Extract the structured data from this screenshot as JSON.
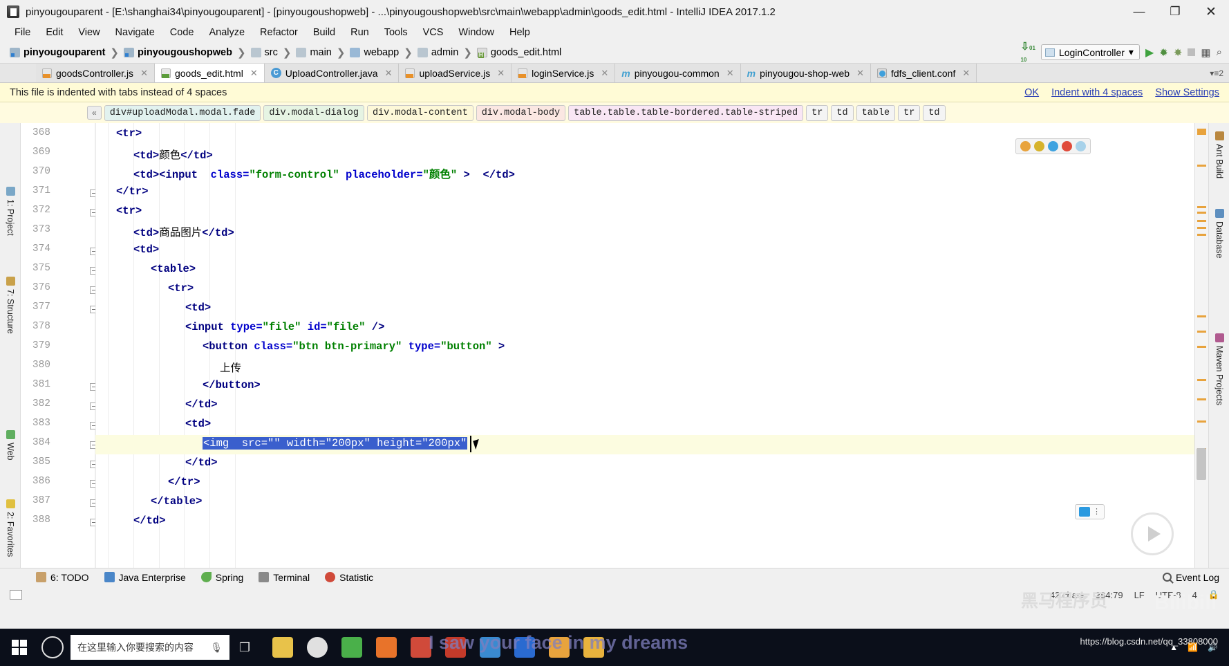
{
  "window": {
    "title": "pinyougouparent - [E:\\shanghai34\\pinyougouparent] - [pinyougoushopweb] - ...\\pinyougoushopweb\\src\\main\\webapp\\admin\\goods_edit.html - IntelliJ IDEA 2017.1.2",
    "minimize": "—",
    "maximize": "❐",
    "close": "✕"
  },
  "menubar": {
    "items": [
      "File",
      "Edit",
      "View",
      "Navigate",
      "Code",
      "Analyze",
      "Refactor",
      "Build",
      "Run",
      "Tools",
      "VCS",
      "Window",
      "Help"
    ]
  },
  "navbar": {
    "crumbs": [
      {
        "label": "pinyougouparent",
        "icon": "module-icon",
        "bold": true
      },
      {
        "label": "pinyougoushopweb",
        "icon": "module-icon",
        "bold": true
      },
      {
        "label": "src",
        "icon": "folder-icon",
        "bold": false
      },
      {
        "label": "main",
        "icon": "folder-icon",
        "bold": false
      },
      {
        "label": "webapp",
        "icon": "folder-blue-icon",
        "bold": false
      },
      {
        "label": "admin",
        "icon": "folder-icon",
        "bold": false
      },
      {
        "label": "goods_edit.html",
        "icon": "html-file-icon",
        "bold": false
      }
    ],
    "separator": "❯",
    "run_config": "LoginController",
    "dropdown_caret": "▾",
    "run_icon": "▶",
    "debug_icon": "🐞",
    "stop_icon": "■",
    "search_icon": "search-icon"
  },
  "tabs": [
    {
      "label": "goodsController.js",
      "icon": "js-file-icon",
      "active": false,
      "close": "✕"
    },
    {
      "label": "goods_edit.html",
      "icon": "html-file-icon",
      "active": true,
      "close": "✕"
    },
    {
      "label": "UploadController.java",
      "icon": "java-class-icon",
      "active": false,
      "close": "✕"
    },
    {
      "label": "uploadService.js",
      "icon": "js-file-icon",
      "active": false,
      "close": "✕"
    },
    {
      "label": "loginService.js",
      "icon": "js-file-icon",
      "active": false,
      "close": "✕"
    },
    {
      "label": "pinyougou-common",
      "icon": "maven-module-icon",
      "active": false,
      "close": "✕"
    },
    {
      "label": "pinyougou-shop-web",
      "icon": "maven-module-icon",
      "active": false,
      "close": "✕"
    },
    {
      "label": "fdfs_client.conf",
      "icon": "conf-file-icon",
      "active": false,
      "close": "✕"
    }
  ],
  "tabs_overflow": "▾≡2",
  "notification": {
    "message": "This file is indented with tabs instead of 4 spaces",
    "links": [
      "OK",
      "Indent with 4 spaces",
      "Show Settings"
    ]
  },
  "breadcrumbs": {
    "collapse": "«",
    "chips": [
      "div#uploadModal.modal.fade",
      "div.modal-dialog",
      "div.modal-content",
      "div.modal-body",
      "table.table.table-bordered.table-striped",
      "tr",
      "td",
      "table",
      "tr",
      "td"
    ]
  },
  "left_toolwindows": [
    {
      "label": "1: Project",
      "icon": "project-icon"
    },
    {
      "label": "7: Structure",
      "icon": "structure-icon"
    },
    {
      "label": "Web",
      "icon": "web-icon"
    },
    {
      "label": "2: Favorites",
      "icon": "favorites-icon"
    }
  ],
  "right_toolwindows": [
    {
      "label": "Ant Build",
      "icon": "ant-icon"
    },
    {
      "label": "Database",
      "icon": "database-icon"
    },
    {
      "label": "Maven Projects",
      "icon": "maven-icon"
    }
  ],
  "editor": {
    "first_line": 368,
    "lines": [
      {
        "no": 368,
        "indent": 4,
        "segs": [
          {
            "t": "<tr>",
            "c": "tag"
          }
        ]
      },
      {
        "no": 369,
        "indent": 5,
        "segs": [
          {
            "t": "<td>",
            "c": "tag"
          },
          {
            "t": "颜色",
            "c": "txt"
          },
          {
            "t": "</td>",
            "c": "tag"
          }
        ]
      },
      {
        "no": 370,
        "indent": 5,
        "segs": [
          {
            "t": "<td>",
            "c": "tag"
          },
          {
            "t": "<input",
            "c": "tag"
          },
          {
            "t": "  ",
            "c": "txt"
          },
          {
            "t": "class=",
            "c": "attr"
          },
          {
            "t": "\"form-control\"",
            "c": "val"
          },
          {
            "t": " ",
            "c": "txt"
          },
          {
            "t": "placeholder=",
            "c": "attr"
          },
          {
            "t": "\"颜色\"",
            "c": "val"
          },
          {
            "t": " >",
            "c": "tag"
          },
          {
            "t": "  ",
            "c": "txt"
          },
          {
            "t": "</td>",
            "c": "tag"
          }
        ]
      },
      {
        "no": 371,
        "indent": 4,
        "segs": [
          {
            "t": "</tr>",
            "c": "tag"
          }
        ]
      },
      {
        "no": 372,
        "indent": 4,
        "segs": [
          {
            "t": "<tr>",
            "c": "tag"
          }
        ]
      },
      {
        "no": 373,
        "indent": 5,
        "segs": [
          {
            "t": "<td>",
            "c": "tag"
          },
          {
            "t": "商品图片",
            "c": "txt"
          },
          {
            "t": "</td>",
            "c": "tag"
          }
        ]
      },
      {
        "no": 374,
        "indent": 5,
        "segs": [
          {
            "t": "<td>",
            "c": "tag"
          }
        ]
      },
      {
        "no": 375,
        "indent": 6,
        "segs": [
          {
            "t": "<table>",
            "c": "tag"
          }
        ]
      },
      {
        "no": 376,
        "indent": 7,
        "segs": [
          {
            "t": "<tr>",
            "c": "tag"
          }
        ]
      },
      {
        "no": 377,
        "indent": 8,
        "segs": [
          {
            "t": "<td>",
            "c": "tag"
          }
        ]
      },
      {
        "no": 378,
        "indent": 8,
        "segs": [
          {
            "t": "<input ",
            "c": "tag"
          },
          {
            "t": "type=",
            "c": "attr"
          },
          {
            "t": "\"file\"",
            "c": "val"
          },
          {
            "t": " ",
            "c": "txt"
          },
          {
            "t": "id=",
            "c": "attr"
          },
          {
            "t": "\"file\"",
            "c": "val"
          },
          {
            "t": " />",
            "c": "tag"
          }
        ]
      },
      {
        "no": 379,
        "indent": 9,
        "segs": [
          {
            "t": "<button ",
            "c": "tag"
          },
          {
            "t": "class=",
            "c": "attr"
          },
          {
            "t": "\"btn btn-primary\"",
            "c": "val"
          },
          {
            "t": " ",
            "c": "txt"
          },
          {
            "t": "type=",
            "c": "attr"
          },
          {
            "t": "\"button\"",
            "c": "val"
          },
          {
            "t": " >",
            "c": "tag"
          }
        ]
      },
      {
        "no": 380,
        "indent": 10,
        "segs": [
          {
            "t": "上传",
            "c": "txt"
          }
        ]
      },
      {
        "no": 381,
        "indent": 9,
        "segs": [
          {
            "t": "</button>",
            "c": "tag"
          }
        ]
      },
      {
        "no": 382,
        "indent": 8,
        "segs": [
          {
            "t": "</td>",
            "c": "tag"
          }
        ]
      },
      {
        "no": 383,
        "indent": 8,
        "segs": [
          {
            "t": "<td>",
            "c": "tag"
          }
        ]
      },
      {
        "no": 384,
        "indent": 9,
        "segs": [
          {
            "t": "<img  src=\"\" width=\"200px\" height=\"200px\"",
            "c": "sel"
          }
        ]
      },
      {
        "no": 385,
        "indent": 8,
        "segs": [
          {
            "t": "</td>",
            "c": "tag"
          }
        ]
      },
      {
        "no": 386,
        "indent": 7,
        "segs": [
          {
            "t": "</tr>",
            "c": "tag"
          }
        ]
      },
      {
        "no": 387,
        "indent": 6,
        "segs": [
          {
            "t": "</table>",
            "c": "tag"
          }
        ]
      },
      {
        "no": 388,
        "indent": 5,
        "segs": [
          {
            "t": "</td>",
            "c": "tag"
          }
        ]
      }
    ],
    "selected_text": "<img  src=\"\" width=\"200px\" height=\"200px\"",
    "color_swatches": [
      "#e8a33d",
      "#d4b02a",
      "#3fa3e0",
      "#e04a3a",
      "#8fc6e8"
    ]
  },
  "bottom_toolwindows": [
    {
      "label": "6: TODO",
      "mnemonic": "6",
      "icon": "todo-icon"
    },
    {
      "label": "Java Enterprise",
      "icon": "java-enterprise-icon"
    },
    {
      "label": "Spring",
      "icon": "spring-leaf-icon"
    },
    {
      "label": "Terminal",
      "icon": "terminal-icon"
    },
    {
      "label": "Statistic",
      "icon": "statistic-icon"
    }
  ],
  "event_log": {
    "label": "Event Log",
    "icon": "search-icon"
  },
  "statusbar": {
    "chars": "42 chars",
    "position": "384:79",
    "line_separator": "LF",
    "encoding": "UTF-8",
    "indent": "4",
    "lock_icon": "lock-icon"
  },
  "taskbar": {
    "search_placeholder": "在这里输入你要搜索的内容",
    "start_icon": "windows-start-icon",
    "cortana_icon": "cortana-icon",
    "mic_icon": "microphone-icon",
    "taskview_icon": "task-view-icon",
    "apps": [
      "explorer-icon",
      "chrome-icon",
      "app-green-icon",
      "idea-icon",
      "app-orange-icon",
      "pdf-icon",
      "editor-icon",
      "blue-app-icon",
      "media-icon",
      "folder-icon"
    ]
  },
  "overlay": {
    "watermark": "I saw your face in my dreams",
    "brand_cn": "黑马程序员",
    "brand_site": "Bilibili",
    "csdn": "https://blog.csdn.net/qq_33808000"
  },
  "colors": {
    "accent_blue": "#3a5fcd",
    "notif_bg": "#fffbd6",
    "tag": "#000080",
    "attr": "#0000cc",
    "value": "#008000"
  }
}
